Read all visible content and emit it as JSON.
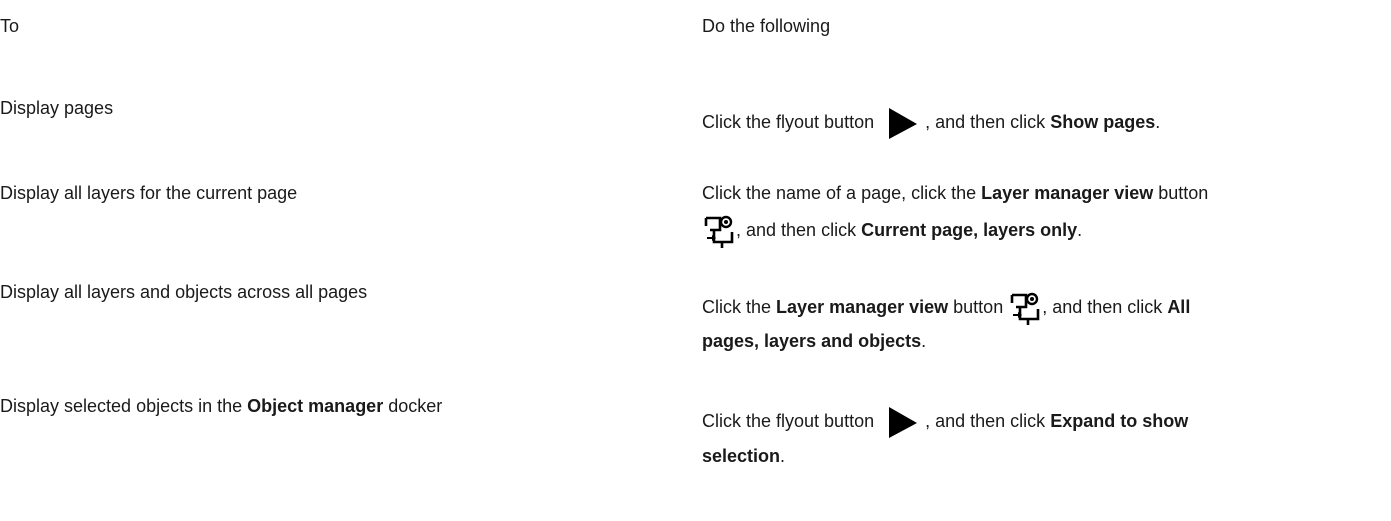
{
  "table": {
    "header": {
      "col_to": "To",
      "col_do": "Do the following"
    },
    "rows": [
      {
        "to": "Display pages",
        "do": {
          "a": "Click the flyout button",
          "b": ", and then click",
          "c": "Show pages",
          "d": "."
        }
      },
      {
        "to": "Display all layers for the current page",
        "do": {
          "a": "Click the name of a page, click the",
          "b": "Layer manager view",
          "c": "button",
          "d": ", and then click",
          "e": "Current page, layers only",
          "f": "."
        }
      },
      {
        "to": "Display all layers and objects across all pages",
        "do": {
          "a": "Click the",
          "b": "Layer manager view",
          "c": "button",
          "d": ", and then click",
          "e": "All",
          "f": "pages, layers and objects",
          "g": "."
        }
      },
      {
        "to": {
          "a": "Display selected objects in the",
          "b": "Object manager",
          "c": "docker"
        },
        "do": {
          "a": "Click the flyout button",
          "b": ", and then click",
          "c": "Expand to show",
          "d": "selection",
          "e": "."
        }
      }
    ]
  },
  "icons": {
    "flyout": "flyout-arrow-icon",
    "layer_manager": "layer-manager-view-icon"
  },
  "colors": {
    "text": "#1a1a1a",
    "icon": "#000000"
  }
}
